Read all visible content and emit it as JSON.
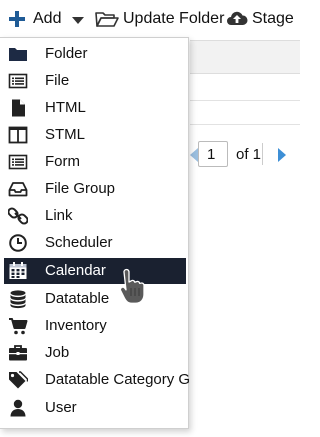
{
  "toolbar": {
    "add_label": "Add",
    "update_folder_label": "Update Folder",
    "stage_label": "Stage"
  },
  "menu": {
    "items": [
      {
        "label": "Folder",
        "icon": "folder-icon"
      },
      {
        "label": "File",
        "icon": "file-list-icon"
      },
      {
        "label": "HTML",
        "icon": "html-page-icon"
      },
      {
        "label": "STML",
        "icon": "stml-columns-icon"
      },
      {
        "label": "Form",
        "icon": "form-icon"
      },
      {
        "label": "File Group",
        "icon": "inbox-tray-icon"
      },
      {
        "label": "Link",
        "icon": "link-icon"
      },
      {
        "label": "Scheduler",
        "icon": "clock-icon"
      },
      {
        "label": "Calendar",
        "icon": "calendar-icon",
        "selected": true
      },
      {
        "label": "Datatable",
        "icon": "database-icon"
      },
      {
        "label": "Inventory",
        "icon": "cart-icon"
      },
      {
        "label": "Job",
        "icon": "briefcase-icon"
      },
      {
        "label": "Datatable Category G",
        "icon": "tags-icon"
      },
      {
        "label": "User",
        "icon": "user-icon"
      }
    ]
  },
  "pager": {
    "current_page": "1",
    "of_text": "of 1"
  },
  "colors": {
    "accent": "#1f5b96",
    "selected_bg": "#1a2130",
    "next_arrow": "#3d8fd6"
  }
}
